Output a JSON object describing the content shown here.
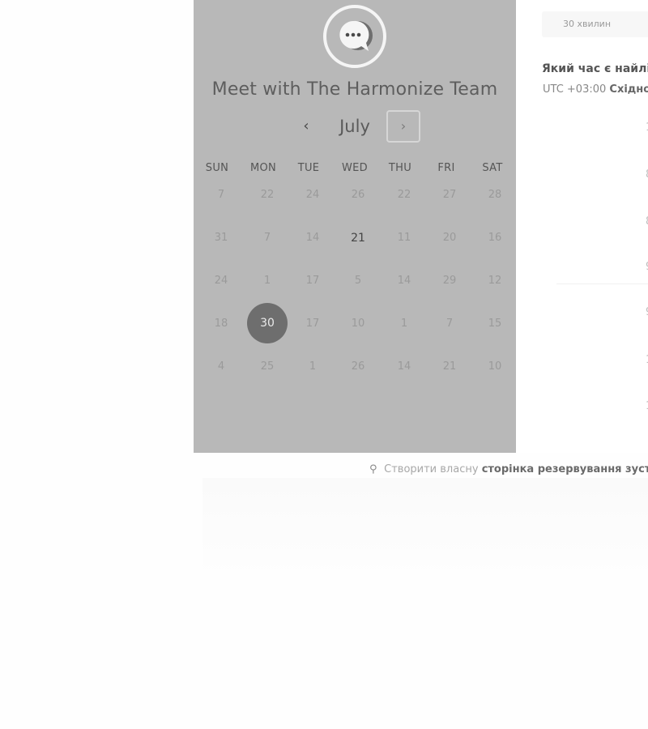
{
  "meeting": {
    "title": "Meet with The Harmonize Team",
    "avatar_icon": "chat-bubble-icon"
  },
  "calendar": {
    "month": "July",
    "prev_icon": "‹",
    "next_icon": "›",
    "day_headers": [
      "SUN",
      "MON",
      "TUE",
      "WED",
      "THU",
      "FRI",
      "SAT"
    ],
    "rows": [
      [
        "7",
        "22",
        "24",
        "26",
        "22",
        "27",
        "28"
      ],
      [
        "31",
        "7",
        "14",
        "21",
        "11",
        "20",
        "16"
      ],
      [
        "24",
        "1",
        "17",
        "5",
        "14",
        "29",
        "12"
      ],
      [
        "18",
        "30",
        "17",
        "10",
        "1",
        "7",
        "15"
      ],
      [
        "4",
        "25",
        "1",
        "26",
        "14",
        "21",
        "10"
      ]
    ],
    "active_day": "21",
    "selected_day": "30"
  },
  "right": {
    "duration": "30 хвилин",
    "question": "Який час є найлі",
    "timezone_prefix": "UTC +03:00",
    "timezone_name": "Східно"
  },
  "footer": {
    "prefix": "Створити власну",
    "link": "сторінка резервування зустрі"
  }
}
